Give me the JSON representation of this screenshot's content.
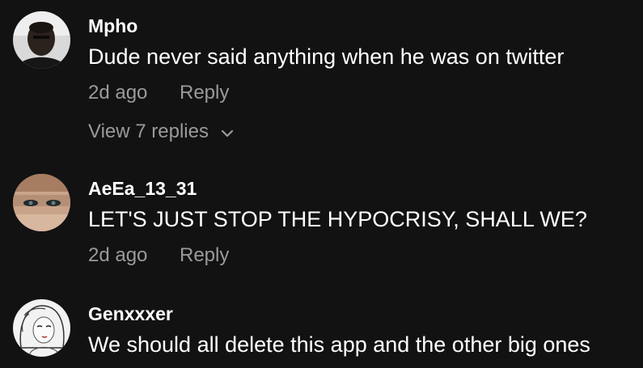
{
  "comments": [
    {
      "username": "Mpho",
      "text": "Dude never said anything when he was on twitter",
      "time": "2d ago",
      "reply_label": "Reply",
      "view_replies": "View 7 replies"
    },
    {
      "username": "AeEa_13_31",
      "text": "LET'S JUST STOP THE HYPOCRISY, SHALL WE?",
      "time": "2d ago",
      "reply_label": "Reply"
    },
    {
      "username": "Genxxxer",
      "text": "We should all delete this app and the other big ones"
    }
  ],
  "icons": {
    "chevron": "chevron-down-icon"
  },
  "colors": {
    "background": "#121212",
    "primary_text": "#ffffff",
    "secondary_text": "#9a9a9a"
  }
}
